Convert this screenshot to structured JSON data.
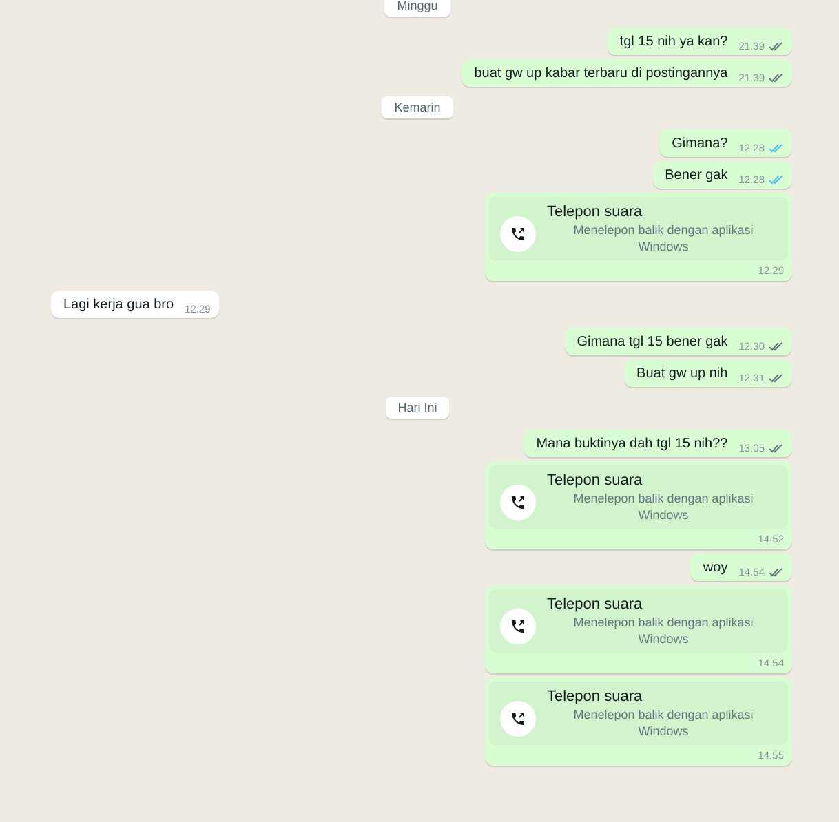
{
  "messages": [
    {
      "kind": "date",
      "text": "Minggu"
    },
    {
      "kind": "text",
      "outgoing": true,
      "text": "tgl 15 nih ya kan?",
      "time": "21.39",
      "read": false
    },
    {
      "kind": "text",
      "outgoing": true,
      "text": "buat gw up kabar terbaru di postingannya",
      "time": "21.39",
      "read": false
    },
    {
      "kind": "date",
      "text": "Kemarin"
    },
    {
      "kind": "text",
      "outgoing": true,
      "text": "Gimana?",
      "time": "12.28",
      "read": true
    },
    {
      "kind": "text",
      "outgoing": true,
      "text": "Bener gak",
      "time": "12.28",
      "read": true
    },
    {
      "kind": "call",
      "outgoing": true,
      "title": "Telepon suara",
      "subtitle": "Menelepon balik dengan aplikasi Windows",
      "time": "12.29"
    },
    {
      "kind": "text",
      "outgoing": false,
      "text": "Lagi kerja gua bro",
      "time": "12.29"
    },
    {
      "kind": "text",
      "outgoing": true,
      "text": "Gimana tgl 15 bener gak",
      "time": "12.30",
      "read": false
    },
    {
      "kind": "text",
      "outgoing": true,
      "text": "Buat gw up nih",
      "time": "12.31",
      "read": false
    },
    {
      "kind": "date",
      "text": "Hari Ini"
    },
    {
      "kind": "text",
      "outgoing": true,
      "text": "Mana buktinya dah tgl 15 nih??",
      "time": "13.05",
      "read": false
    },
    {
      "kind": "call",
      "outgoing": true,
      "title": "Telepon suara",
      "subtitle": "Menelepon balik dengan aplikasi Windows",
      "time": "14.52"
    },
    {
      "kind": "text",
      "outgoing": true,
      "text": "woy",
      "time": "14.54",
      "read": false
    },
    {
      "kind": "call",
      "outgoing": true,
      "title": "Telepon suara",
      "subtitle": "Menelepon balik dengan aplikasi Windows",
      "time": "14.54"
    },
    {
      "kind": "call",
      "outgoing": true,
      "title": "Telepon suara",
      "subtitle": "Menelepon balik dengan aplikasi Windows",
      "time": "14.55"
    }
  ]
}
